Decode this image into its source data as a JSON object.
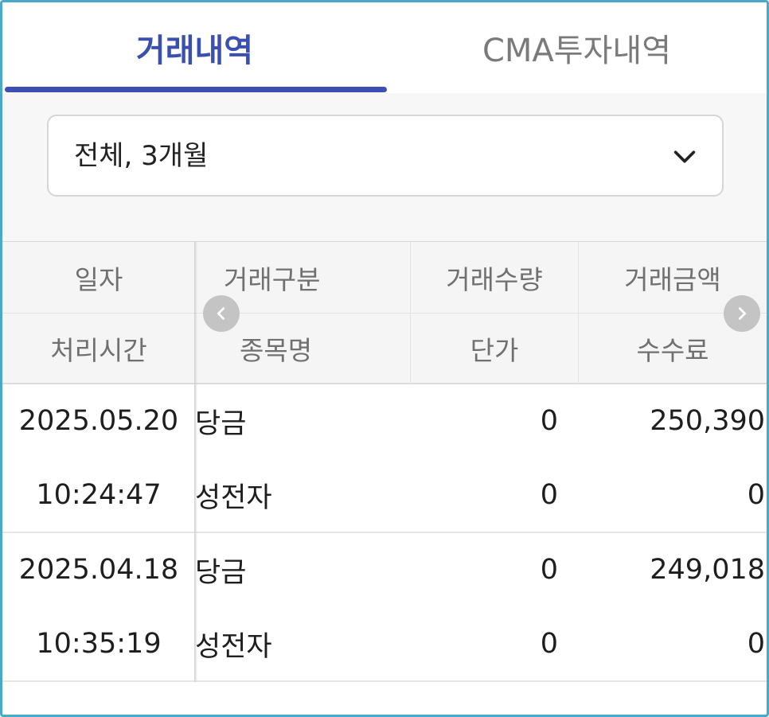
{
  "tabs": [
    {
      "label": "거래내역",
      "active": true
    },
    {
      "label": "CMA투자내역",
      "active": false
    }
  ],
  "filter": {
    "value": "전체, 3개월"
  },
  "table": {
    "headers": {
      "row1": [
        "일자",
        "거래구분",
        "거래수량",
        "거래금액"
      ],
      "row2": [
        "처리시간",
        "종목명",
        "단가",
        "수수료"
      ]
    },
    "records": [
      {
        "date": "2025.05.20",
        "type": "당금",
        "qty": "0",
        "amount": "250,390",
        "time": "10:24:47",
        "name": "성전자",
        "price": "0",
        "fee": "0"
      },
      {
        "date": "2025.04.18",
        "type": "당금",
        "qty": "0",
        "amount": "249,018",
        "time": "10:35:19",
        "name": "성전자",
        "price": "0",
        "fee": "0"
      }
    ]
  },
  "icons": {
    "dropdown": "chevron-down-icon",
    "prev": "chevron-left-icon",
    "next": "chevron-right-icon"
  },
  "colors": {
    "accent": "#3d4fb5",
    "border": "#4aa8c8"
  }
}
